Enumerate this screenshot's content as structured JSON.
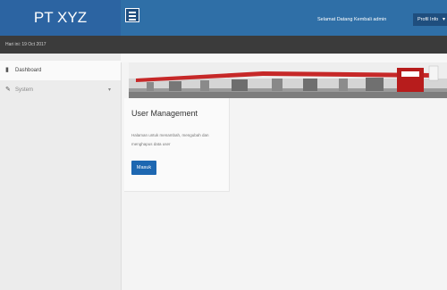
{
  "header": {
    "brand": "PT XYZ",
    "welcome": "Selamat Datang Kembali admin",
    "profile_button": "Profil Info"
  },
  "subheader": {
    "date": "Hari ini: 19 Oct 2017"
  },
  "sidebar": {
    "items": [
      {
        "label": "Dashboard",
        "icon": "bar-chart-icon"
      },
      {
        "label": "System",
        "icon": "wrench-icon",
        "has_submenu": true
      }
    ]
  },
  "card": {
    "title": "User Management",
    "description": "Halaman untuk menambah, mengubah dan menghapus data user",
    "button": "Masuk"
  },
  "colors": {
    "primary": "#2f6fa7",
    "brand_bg": "#2c64a2",
    "subbar": "#3b3b3b",
    "button": "#1d67b1",
    "banner_accent": "#c62828"
  }
}
